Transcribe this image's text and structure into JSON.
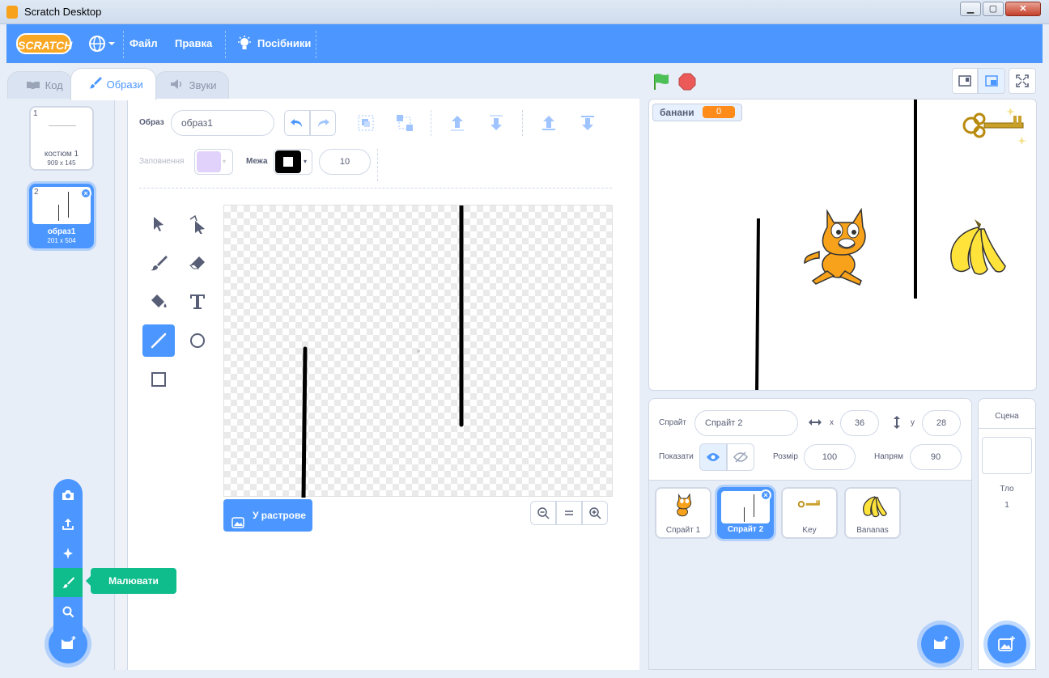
{
  "window": {
    "title": "Scratch Desktop",
    "min": "▁",
    "max": "▢",
    "close": "✕"
  },
  "menubar": {
    "logo": "SCRATCH",
    "file": "Файл",
    "edit": "Правка",
    "tutorials": "Посібники"
  },
  "tabs": [
    {
      "label": "Код"
    },
    {
      "label": "Образи"
    },
    {
      "label": "Звуки"
    }
  ],
  "costumes": [
    {
      "num": "1",
      "name": "костюм 1",
      "size": "909 x 145"
    },
    {
      "num": "2",
      "name": "образ1",
      "size": "201 x 504"
    }
  ],
  "paint_editor": {
    "costume_label": "Образ",
    "costume_name": "образ1",
    "fill_label": "Заповнення",
    "outline_label": "Межа",
    "outline_width": "10",
    "convert_button": "У растрове"
  },
  "add_menu": {
    "tooltip": "Малювати"
  },
  "stage": {
    "variable_name": "банани",
    "variable_value": "0"
  },
  "sprite_info": {
    "sprite_label": "Спрайт",
    "sprite_name": "Спрайт 2",
    "x_label": "x",
    "x": "36",
    "y_label": "y",
    "y": "28",
    "show_label": "Показати",
    "size_label": "Розмір",
    "size": "100",
    "direction_label": "Напрям",
    "direction": "90"
  },
  "sprites": [
    {
      "name": "Спрайт 1"
    },
    {
      "name": "Спрайт 2"
    },
    {
      "name": "Key"
    },
    {
      "name": "Bananas"
    }
  ],
  "stage_pane": {
    "title": "Сцена",
    "backdrop_label": "Тло",
    "backdrop_count": "1"
  },
  "colors": {
    "accent": "#4c97ff",
    "green": "#0fbd8c",
    "orange": "#ff8c1a"
  }
}
